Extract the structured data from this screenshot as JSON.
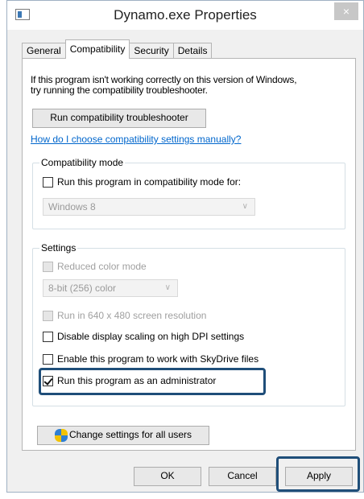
{
  "window": {
    "title": "Dynamo.exe Properties",
    "close_glyph": "×"
  },
  "tabs": [
    {
      "label": "General",
      "active": false
    },
    {
      "label": "Compatibility",
      "active": true
    },
    {
      "label": "Security",
      "active": false
    },
    {
      "label": "Details",
      "active": false
    }
  ],
  "intro": {
    "line1": "If this program isn't working correctly on this version of Windows,",
    "line2": "try running the compatibility troubleshooter."
  },
  "troubleshooter_button": "Run compatibility troubleshooter",
  "manual_link": "How do I choose compatibility settings manually?",
  "compat_mode": {
    "group_label": "Compatibility mode",
    "checkbox_label": "Run this program in compatibility mode for:",
    "checked": false,
    "os_value": "Windows 8"
  },
  "settings": {
    "group_label": "Settings",
    "reduced_color_label": "Reduced color mode",
    "color_value": "8-bit (256) color",
    "res_label": "Run in 640 x 480 screen resolution",
    "dpi_label": "Disable display scaling on high DPI settings",
    "skydrive_label": "Enable this program to work with SkyDrive files",
    "admin_label": "Run this program as an administrator",
    "admin_checked": true
  },
  "change_all_button": "Change settings for all users",
  "footer": {
    "ok": "OK",
    "cancel": "Cancel",
    "apply": "Apply"
  },
  "colors": {
    "highlight": "#1f4e79",
    "link": "#0066cc"
  },
  "icons": {
    "app": "application-window-icon",
    "close": "close-icon",
    "shield": "uac-shield-icon",
    "chevron": "chevron-down-icon"
  }
}
